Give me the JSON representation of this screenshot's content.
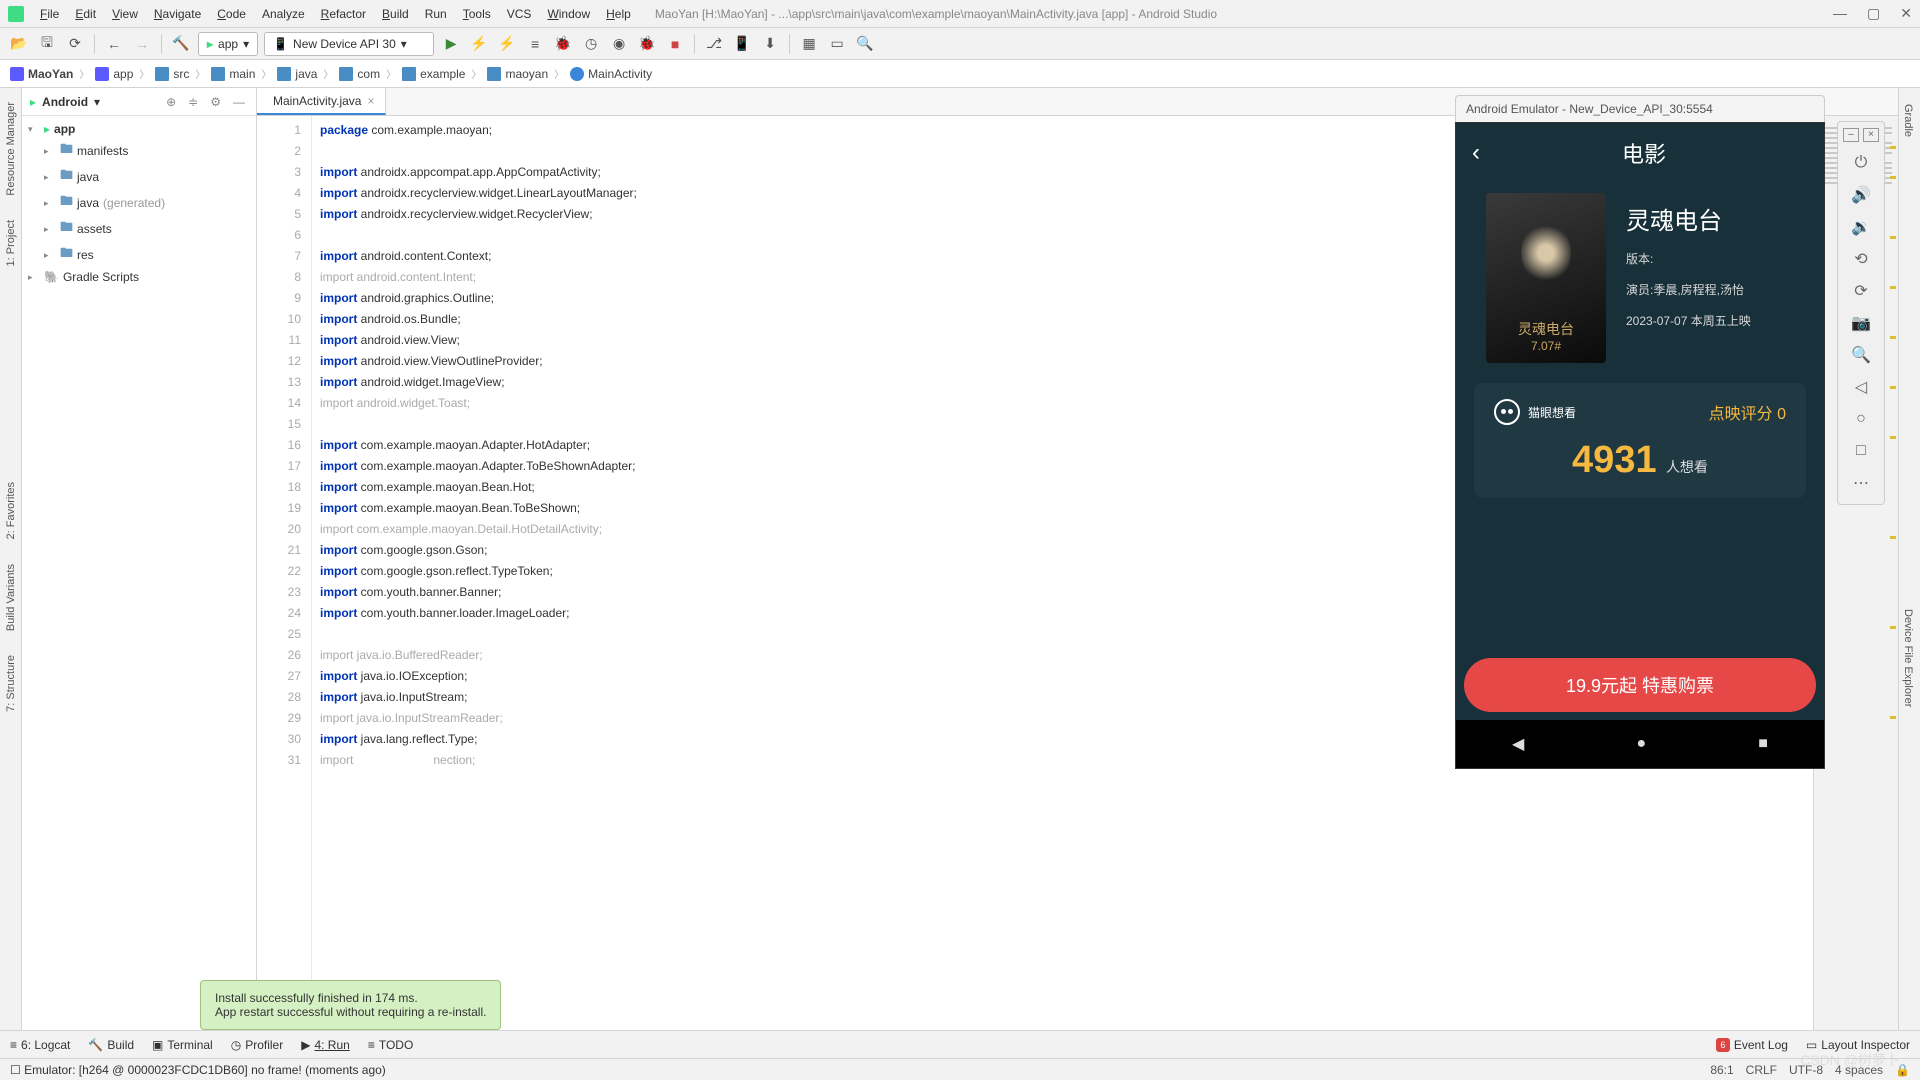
{
  "window": {
    "title": "MaoYan [H:\\MaoYan] - ...\\app\\src\\main\\java\\com\\example\\maoyan\\MainActivity.java [app] - Android Studio"
  },
  "menu": {
    "file": "File",
    "edit": "Edit",
    "view": "View",
    "navigate": "Navigate",
    "code": "Code",
    "analyze": "Analyze",
    "refactor": "Refactor",
    "build": "Build",
    "run": "Run",
    "tools": "Tools",
    "vcs": "VCS",
    "window": "Window",
    "help": "Help"
  },
  "run_config": {
    "app": "app",
    "device": "New Device API 30",
    "device_arrow": "▾"
  },
  "breadcrumb": [
    "MaoYan",
    "app",
    "src",
    "main",
    "java",
    "com",
    "example",
    "maoyan",
    "MainActivity"
  ],
  "project": {
    "label": "Android",
    "tree": {
      "app": "app",
      "manifests": "manifests",
      "java": "java",
      "java_gen": "java",
      "java_gen_suffix": "(generated)",
      "assets": "assets",
      "res": "res",
      "gradle": "Gradle Scripts"
    }
  },
  "tab": {
    "name": "MainActivity.java"
  },
  "code": {
    "lines": [
      {
        "n": 1,
        "kw": "package",
        "tx": " com.example.maoyan;",
        "gray": false
      },
      {
        "n": 2,
        "kw": "",
        "tx": "",
        "gray": false
      },
      {
        "n": 3,
        "kw": "import",
        "tx": " androidx.appcompat.app.AppCompatActivity;",
        "gray": false
      },
      {
        "n": 4,
        "kw": "import",
        "tx": " androidx.recyclerview.widget.LinearLayoutManager;",
        "gray": false
      },
      {
        "n": 5,
        "kw": "import",
        "tx": " androidx.recyclerview.widget.RecyclerView;",
        "gray": false
      },
      {
        "n": 6,
        "kw": "",
        "tx": "",
        "gray": false
      },
      {
        "n": 7,
        "kw": "import",
        "tx": " android.content.Context;",
        "gray": false
      },
      {
        "n": 8,
        "kw": "import",
        "tx": " android.content.Intent;",
        "gray": true
      },
      {
        "n": 9,
        "kw": "import",
        "tx": " android.graphics.Outline;",
        "gray": false
      },
      {
        "n": 10,
        "kw": "import",
        "tx": " android.os.Bundle;",
        "gray": false
      },
      {
        "n": 11,
        "kw": "import",
        "tx": " android.view.View;",
        "gray": false
      },
      {
        "n": 12,
        "kw": "import",
        "tx": " android.view.ViewOutlineProvider;",
        "gray": false
      },
      {
        "n": 13,
        "kw": "import",
        "tx": " android.widget.ImageView;",
        "gray": false
      },
      {
        "n": 14,
        "kw": "import",
        "tx": " android.widget.Toast;",
        "gray": true
      },
      {
        "n": 15,
        "kw": "",
        "tx": "",
        "gray": false
      },
      {
        "n": 16,
        "kw": "import",
        "tx": " com.example.maoyan.Adapter.HotAdapter;",
        "gray": false
      },
      {
        "n": 17,
        "kw": "import",
        "tx": " com.example.maoyan.Adapter.ToBeShownAdapter;",
        "gray": false
      },
      {
        "n": 18,
        "kw": "import",
        "tx": " com.example.maoyan.Bean.Hot;",
        "gray": false
      },
      {
        "n": 19,
        "kw": "import",
        "tx": " com.example.maoyan.Bean.ToBeShown;",
        "gray": false
      },
      {
        "n": 20,
        "kw": "import",
        "tx": " com.example.maoyan.Detail.HotDetailActivity;",
        "gray": true
      },
      {
        "n": 21,
        "kw": "import",
        "tx": " com.google.gson.Gson;",
        "gray": false
      },
      {
        "n": 22,
        "kw": "import",
        "tx": " com.google.gson.reflect.TypeToken;",
        "gray": false
      },
      {
        "n": 23,
        "kw": "import",
        "tx": " com.youth.banner.Banner;",
        "gray": false
      },
      {
        "n": 24,
        "kw": "import",
        "tx": " com.youth.banner.loader.ImageLoader;",
        "gray": false
      },
      {
        "n": 25,
        "kw": "",
        "tx": "",
        "gray": false
      },
      {
        "n": 26,
        "kw": "import",
        "tx": " java.io.BufferedReader;",
        "gray": true
      },
      {
        "n": 27,
        "kw": "import",
        "tx": " java.io.IOException;",
        "gray": false
      },
      {
        "n": 28,
        "kw": "import",
        "tx": " java.io.InputStream;",
        "gray": false
      },
      {
        "n": 29,
        "kw": "import",
        "tx": " java.io.InputStreamReader;",
        "gray": true
      },
      {
        "n": 30,
        "kw": "import",
        "tx": " java.lang.reflect.Type;",
        "gray": false
      },
      {
        "n": 31,
        "kw": "import",
        "tx": "                        nection;",
        "gray": true
      }
    ]
  },
  "notification": {
    "line1": "Install successfully finished in 174 ms.",
    "line2": "App restart successful without requiring a re-install."
  },
  "bottom": {
    "logcat": "6: Logcat",
    "build": "Build",
    "terminal": "Terminal",
    "profiler": "Profiler",
    "run": "4: Run",
    "todo": "TODO",
    "eventlog": "Event Log",
    "layout": "Layout Inspector",
    "event_count": "6"
  },
  "status": {
    "msg": "Emulator: [h264 @ 0000023FCDC1DB60] no frame! (moments ago)",
    "pos": "86:1",
    "crlf": "CRLF",
    "enc": "UTF-8",
    "indent": "4 spaces"
  },
  "left_tools": {
    "rm": "Resource Manager",
    "proj": "1: Project",
    "fav": "2: Favorites",
    "bv": "Build Variants",
    "str": "7: Structure"
  },
  "right_tools": {
    "gradle": "Gradle",
    "dfe": "Device File Explorer"
  },
  "emulator": {
    "title": "Android Emulator - New_Device_API_30:5554",
    "page_title": "电影",
    "movie": {
      "name": "灵魂电台",
      "version": "版本:",
      "cast": "演员:季晨,房程程,汤怡",
      "date": "2023-07-07 本周五上映",
      "poster_tag": "灵魂电台",
      "poster_sub": "7.07#"
    },
    "rating": {
      "want": "猫眼想看",
      "score": "点映评分 0",
      "count": "4931",
      "count_label": "人想看"
    },
    "buy": "19.9元起 特惠购票"
  }
}
